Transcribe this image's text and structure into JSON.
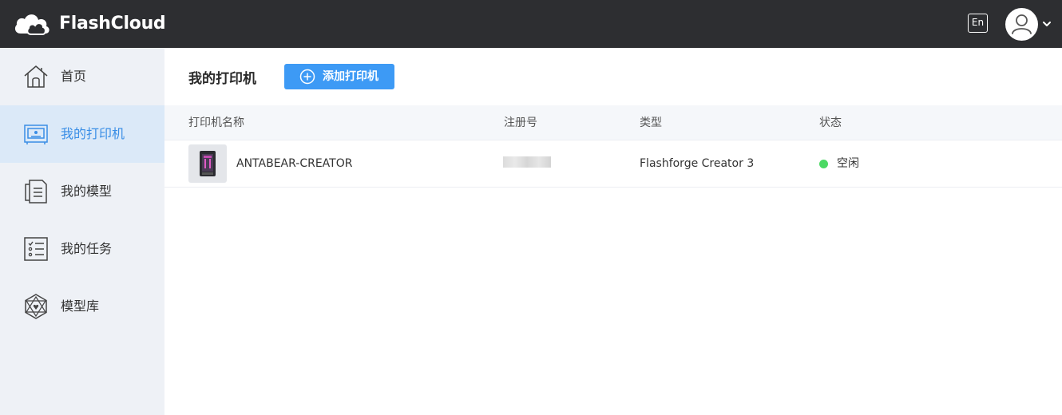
{
  "header": {
    "brand": "FlashCloud",
    "language_button": "En",
    "icons": {
      "logo": "cloud-logo-icon",
      "avatar": "user-avatar-icon",
      "caret": "chevron-down-icon"
    }
  },
  "sidebar": {
    "items": [
      {
        "label": "首页",
        "icon": "home-icon",
        "active": false
      },
      {
        "label": "我的打印机",
        "icon": "printer-icon",
        "active": true
      },
      {
        "label": "我的模型",
        "icon": "document-icon",
        "active": false
      },
      {
        "label": "我的任务",
        "icon": "task-list-icon",
        "active": false
      },
      {
        "label": "模型库",
        "icon": "model-library-icon",
        "active": false
      }
    ]
  },
  "main": {
    "title": "我的打印机",
    "add_button": {
      "label": "添加打印机",
      "icon": "plus-circle-icon"
    },
    "table": {
      "columns": [
        "打印机名称",
        "注册号",
        "类型",
        "状态"
      ],
      "rows": [
        {
          "name": "ANTABEAR-CREATOR",
          "registration": "",
          "type": "Flashforge Creator 3",
          "status": "空闲",
          "status_color": "#4cd964",
          "thumb_icon": "printer-thumbnail-icon"
        }
      ]
    }
  },
  "colors": {
    "topbar": "#2d2e31",
    "sidebar": "#eef1f6",
    "sidebar_active": "#dbe9f8",
    "accent": "#3d9af5",
    "active_text": "#3a8ee6"
  }
}
